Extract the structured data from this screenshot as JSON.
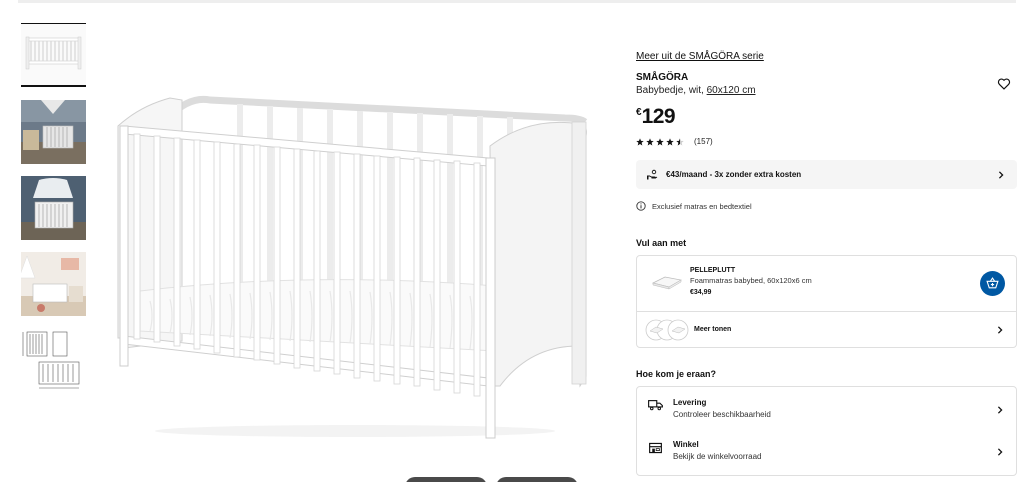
{
  "gallery": {
    "thumbnails": [
      {
        "label": "crib front view",
        "active": true
      },
      {
        "label": "nursery room scene",
        "active": false
      },
      {
        "label": "crib with canopy",
        "active": false
      },
      {
        "label": "bright nursery room",
        "active": false
      },
      {
        "label": "dimension drawing",
        "active": false
      }
    ]
  },
  "product": {
    "series_link": "Meer uit de SMÅGÖRA serie",
    "name": "SMÅGÖRA",
    "desc_prefix": "Babybedje, wit, ",
    "desc_size": "60x120 cm",
    "price_currency": "€",
    "price_amount": "129",
    "rating_value": 4.5,
    "rating_count": "(157)"
  },
  "installment": {
    "text": "€43/maand - 3x zonder extra kosten"
  },
  "info": {
    "text": "Exclusief matras en bedtextiel"
  },
  "complete_section": {
    "title": "Vul aan met",
    "item": {
      "name": "PELLEPLUTT",
      "desc": "Foammatras babybed, 60x120x6 cm",
      "price": "€34,99"
    },
    "more_label": "Meer tonen"
  },
  "delivery_section": {
    "title": "Hoe kom je eraan?",
    "options": [
      {
        "title": "Levering",
        "subtitle": "Controleer beschikbaarheid"
      },
      {
        "title": "Winkel",
        "subtitle": "Bekijk de winkelvoorraad"
      }
    ]
  },
  "colors": {
    "accent_blue": "#0058a3",
    "text": "#111111",
    "panel_bg": "#f5f5f5",
    "border": "#dfdfdf"
  }
}
